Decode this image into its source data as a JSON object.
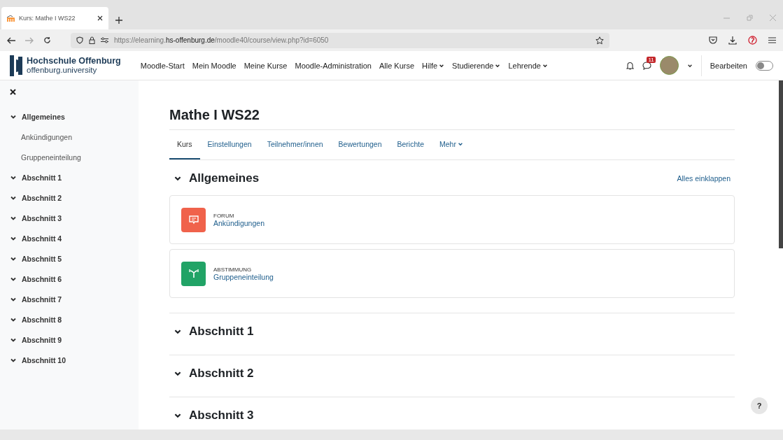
{
  "browser": {
    "tab_title": "Kurs: Mathe I WS22",
    "url_prefix": "https://elearning.",
    "url_host": "hs-offenburg.de",
    "url_path": "/moodle40/course/view.php?id=6050"
  },
  "navbar": {
    "logo_name": "Hochschule Offenburg",
    "logo_sub": "offenburg.university",
    "items": [
      {
        "label": "Moodle-Start",
        "dropdown": false
      },
      {
        "label": "Mein Moodle",
        "dropdown": false
      },
      {
        "label": "Meine Kurse",
        "dropdown": false
      },
      {
        "label": "Moodle-Administration",
        "dropdown": false
      },
      {
        "label": "Alle Kurse",
        "dropdown": false
      },
      {
        "label": "Hilfe",
        "dropdown": true
      },
      {
        "label": "Studierende",
        "dropdown": true
      },
      {
        "label": "Lehrende",
        "dropdown": true
      }
    ],
    "message_badge": "11",
    "edit_label": "Bearbeiten",
    "edit_mode": false
  },
  "sidebar": {
    "items": [
      {
        "label": "Allgemeines",
        "expanded": true,
        "children": [
          {
            "label": "Ankündigungen"
          },
          {
            "label": "Gruppeneinteilung"
          }
        ]
      },
      {
        "label": "Abschnitt 1",
        "expanded": true
      },
      {
        "label": "Abschnitt 2",
        "expanded": true
      },
      {
        "label": "Abschnitt 3",
        "expanded": true
      },
      {
        "label": "Abschnitt 4",
        "expanded": true
      },
      {
        "label": "Abschnitt 5",
        "expanded": true
      },
      {
        "label": "Abschnitt 6",
        "expanded": true
      },
      {
        "label": "Abschnitt 7",
        "expanded": true
      },
      {
        "label": "Abschnitt 8",
        "expanded": true
      },
      {
        "label": "Abschnitt 9",
        "expanded": true
      },
      {
        "label": "Abschnitt 10",
        "expanded": true
      }
    ]
  },
  "course": {
    "title": "Mathe I WS22",
    "tabs": [
      {
        "label": "Kurs",
        "selected": true,
        "dropdown": false
      },
      {
        "label": "Einstellungen",
        "selected": false,
        "dropdown": false
      },
      {
        "label": "Teilnehmer/innen",
        "selected": false,
        "dropdown": false
      },
      {
        "label": "Bewertungen",
        "selected": false,
        "dropdown": false
      },
      {
        "label": "Berichte",
        "selected": false,
        "dropdown": false
      },
      {
        "label": "Mehr",
        "selected": false,
        "dropdown": true
      }
    ],
    "collapse_all": "Alles einklappen",
    "sections": [
      {
        "title": "Allgemeines",
        "expanded": true,
        "activities": [
          {
            "kind": "forum",
            "type_label": "FORUM",
            "name": "Ankündigungen"
          },
          {
            "kind": "choice",
            "type_label": "ABSTIMMUNG",
            "name": "Gruppeneinteilung"
          }
        ]
      },
      {
        "title": "Abschnitt 1",
        "expanded": true
      },
      {
        "title": "Abschnitt 2",
        "expanded": true
      },
      {
        "title": "Abschnitt 3",
        "expanded": true
      }
    ]
  },
  "help_button": "?"
}
